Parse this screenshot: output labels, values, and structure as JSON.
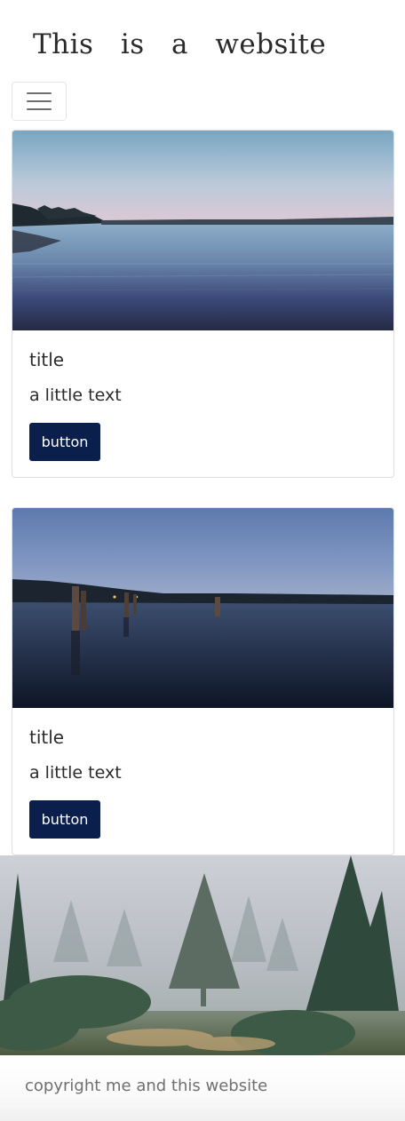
{
  "header": {
    "site_title": "This is a website"
  },
  "cards": [
    {
      "title": "title",
      "text": "a little text",
      "button_label": "button"
    },
    {
      "title": "title",
      "text": "a little text",
      "button_label": "button"
    }
  ],
  "footer": {
    "copyright": "copyright me and this website"
  },
  "colors": {
    "button_background": "#0b1f4d",
    "button_text": "#ffffff",
    "footer_text": "#6f6f6f"
  },
  "icons": {
    "menu": "hamburger-icon"
  }
}
